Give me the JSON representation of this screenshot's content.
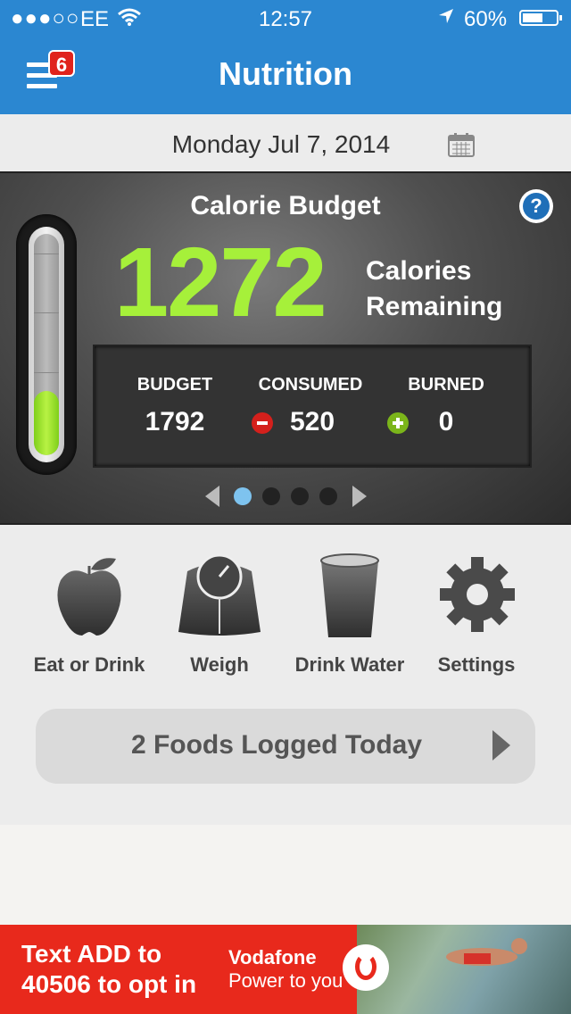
{
  "status_bar": {
    "signal": "●●●○○",
    "carrier": "EE",
    "time": "12:57",
    "battery_percent": "60%",
    "battery_level": 0.6
  },
  "nav": {
    "title": "Nutrition",
    "notification_count": "6"
  },
  "date_bar": {
    "date": "Monday Jul 7, 2014"
  },
  "calorie_card": {
    "title": "Calorie Budget",
    "help_symbol": "?",
    "remaining_value": "1272",
    "remaining_label_line1": "Calories",
    "remaining_label_line2": "Remaining",
    "gauge_level": 0.29,
    "stats": {
      "budget_label": "BUDGET",
      "budget_value": "1792",
      "consumed_label": "CONSUMED",
      "consumed_value": "520",
      "burned_label": "BURNED",
      "burned_value": "0"
    },
    "pager": {
      "page_count": 4,
      "active_page": 1
    }
  },
  "actions": [
    {
      "label": "Eat or Drink",
      "icon": "apple-icon"
    },
    {
      "label": "Weigh",
      "icon": "scale-icon"
    },
    {
      "label": "Drink Water",
      "icon": "glass-icon"
    },
    {
      "label": "Settings",
      "icon": "gear-icon"
    }
  ],
  "foods_logged": {
    "label": "2 Foods Logged Today"
  },
  "ad": {
    "text_line1": "Text ADD to",
    "text_line2": "40506 to opt in",
    "brand": "Vodafone",
    "tagline": "Power to you"
  },
  "colors": {
    "header_blue": "#2b87d1",
    "remaining_green": "#a6f03a",
    "pager_active": "#7ec3ef",
    "ad_red": "#e8291c"
  }
}
